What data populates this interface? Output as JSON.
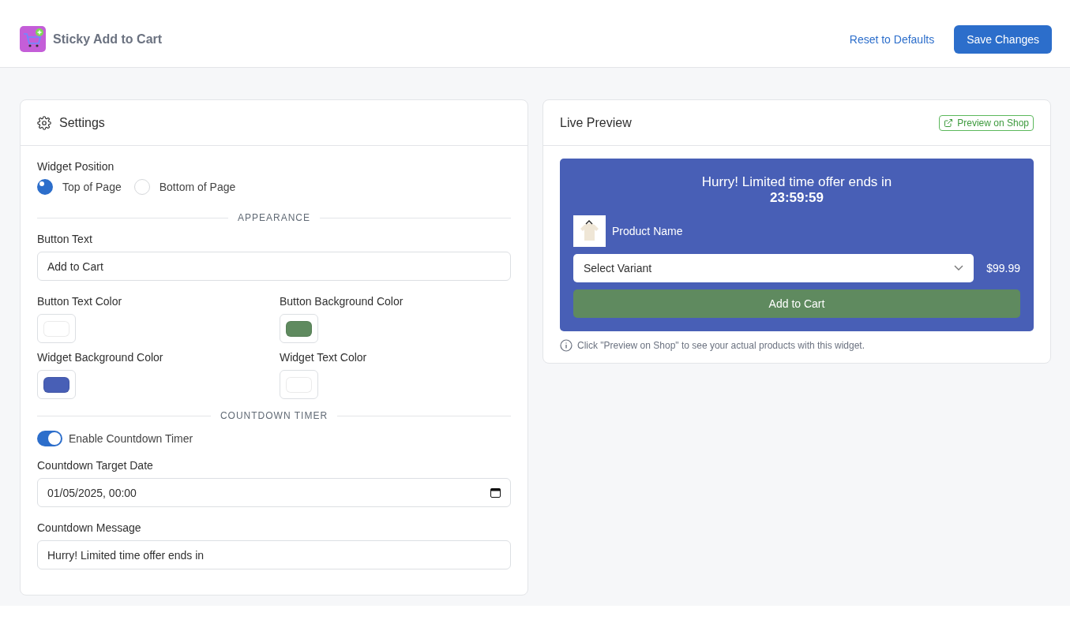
{
  "header": {
    "title": "Sticky Add to Cart",
    "reset_link": "Reset to Defaults",
    "save_button": "Save Changes"
  },
  "settings": {
    "title": "Settings",
    "position": {
      "label": "Widget Position",
      "options": [
        {
          "label": "Top of Page",
          "selected": true
        },
        {
          "label": "Bottom of Page",
          "selected": false
        }
      ]
    },
    "appearance_heading": "APPEARANCE",
    "button_text": {
      "label": "Button Text",
      "value": "Add to Cart"
    },
    "colors": [
      {
        "label": "Button Text Color",
        "color": "#ffffff"
      },
      {
        "label": "Button Background Color",
        "color": "#5f8a5f"
      },
      {
        "label": "Widget Background Color",
        "color": "#485fb6"
      },
      {
        "label": "Widget Text Color",
        "color": "#ffffff"
      }
    ],
    "countdown_heading": "COUNTDOWN TIMER",
    "enable_timer": {
      "label": "Enable Countdown Timer",
      "on": true
    },
    "target_date": {
      "label": "Countdown Target Date",
      "value": "01/05/2025, 00:00"
    },
    "message": {
      "label": "Countdown Message",
      "value": "Hurry! Limited time offer ends in"
    }
  },
  "preview": {
    "title": "Live Preview",
    "shop_link": "Preview on Shop",
    "message": "Hurry! Limited time offer ends in",
    "timer": "23:59:59",
    "product_name": "Product Name",
    "variant": "Select Variant",
    "price": "$99.99",
    "button": "Add to Cart",
    "note": "Click \"Preview on Shop\" to see your actual products with this widget."
  }
}
